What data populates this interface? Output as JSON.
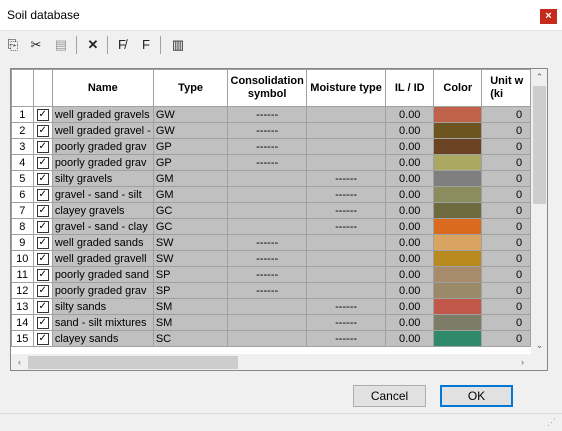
{
  "window": {
    "title": "Soil database",
    "close_glyph": "×"
  },
  "toolbar": [
    {
      "name": "copy-icon",
      "glyph": "⎘"
    },
    {
      "name": "cut-icon",
      "glyph": "✂"
    },
    {
      "name": "paste-icon",
      "glyph": "📋"
    },
    {
      "name": "delete-icon",
      "glyph": "✕"
    },
    {
      "name": "filter-f-icon",
      "glyph": "F̸"
    },
    {
      "name": "filter-icon",
      "glyph": "F"
    },
    {
      "name": "columns-icon",
      "glyph": "▥"
    }
  ],
  "grid": {
    "headers": [
      "",
      "",
      "Name",
      "Type",
      "Consolidation symbol",
      "Moisture type",
      "IL / ID",
      "Color",
      "Unit w (ki"
    ],
    "rows": [
      {
        "n": "1",
        "name": "well graded gravels",
        "type": "GW",
        "cons": "------",
        "moist": "",
        "il": "0.00",
        "color": "#c0624a",
        "unit": "0"
      },
      {
        "n": "2",
        "name": "well graded gravel -",
        "type": "GW",
        "cons": "------",
        "moist": "",
        "il": "0.00",
        "color": "#6e5520",
        "unit": "0"
      },
      {
        "n": "3",
        "name": "poorly graded grav",
        "type": "GP",
        "cons": "------",
        "moist": "",
        "il": "0.00",
        "color": "#6b4224",
        "unit": "0"
      },
      {
        "n": "4",
        "name": "poorly graded grav",
        "type": "GP",
        "cons": "------",
        "moist": "",
        "il": "0.00",
        "color": "#aaa862",
        "unit": "0"
      },
      {
        "n": "5",
        "name": "silty gravels",
        "type": "GM",
        "cons": "",
        "moist": "------",
        "il": "0.00",
        "color": "#7f7f7f",
        "unit": "0"
      },
      {
        "n": "6",
        "name": "gravel - sand - silt",
        "type": "GM",
        "cons": "",
        "moist": "------",
        "il": "0.00",
        "color": "#8c8d5e",
        "unit": "0"
      },
      {
        "n": "7",
        "name": "clayey gravels",
        "type": "GC",
        "cons": "",
        "moist": "------",
        "il": "0.00",
        "color": "#6c6a3e",
        "unit": "0"
      },
      {
        "n": "8",
        "name": "gravel - sand - clay",
        "type": "GC",
        "cons": "",
        "moist": "------",
        "il": "0.00",
        "color": "#d96a1e",
        "unit": "0"
      },
      {
        "n": "9",
        "name": "well graded sands",
        "type": "SW",
        "cons": "------",
        "moist": "",
        "il": "0.00",
        "color": "#d9a462",
        "unit": "0"
      },
      {
        "n": "10",
        "name": "well graded gravell",
        "type": "SW",
        "cons": "------",
        "moist": "",
        "il": "0.00",
        "color": "#b88a1f",
        "unit": "0"
      },
      {
        "n": "11",
        "name": "poorly graded sand",
        "type": "SP",
        "cons": "------",
        "moist": "",
        "il": "0.00",
        "color": "#a78b6a",
        "unit": "0"
      },
      {
        "n": "12",
        "name": "poorly graded grav",
        "type": "SP",
        "cons": "------",
        "moist": "",
        "il": "0.00",
        "color": "#9b8a6a",
        "unit": "0"
      },
      {
        "n": "13",
        "name": "silty sands",
        "type": "SM",
        "cons": "",
        "moist": "------",
        "il": "0.00",
        "color": "#c2584a",
        "unit": "0"
      },
      {
        "n": "14",
        "name": "sand - silt mixtures",
        "type": "SM",
        "cons": "",
        "moist": "------",
        "il": "0.00",
        "color": "#7d7d66",
        "unit": "0"
      },
      {
        "n": "15",
        "name": "clayey sands",
        "type": "SC",
        "cons": "",
        "moist": "------",
        "il": "0.00",
        "color": "#2f8a6c",
        "unit": "0"
      }
    ]
  },
  "buttons": {
    "cancel": "Cancel",
    "ok": "OK"
  }
}
